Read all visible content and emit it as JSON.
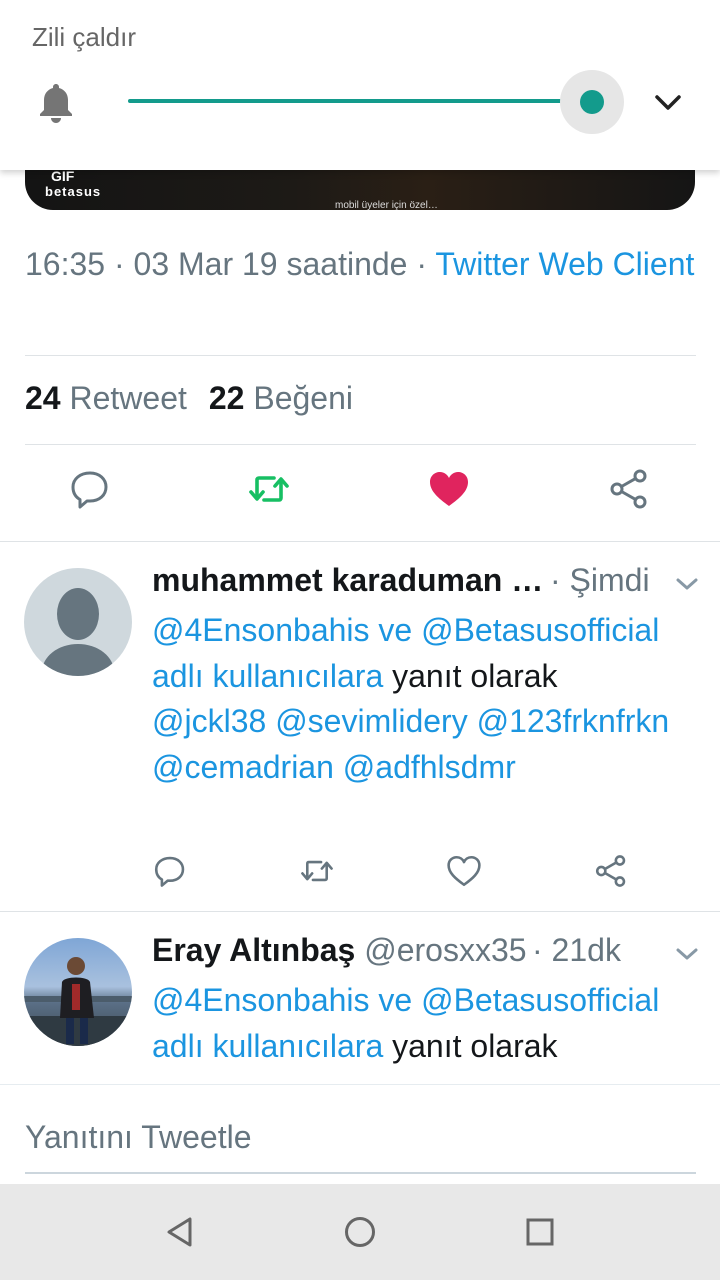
{
  "volume": {
    "title": "Zili çaldır",
    "level": 1.0,
    "accent": "#139b8c",
    "icons": [
      "bell-icon",
      "chevron-down-icon"
    ]
  },
  "media": {
    "gif_label": "GIF",
    "brand": "betasus",
    "caption": "mobil üyeler için özel…"
  },
  "tweet": {
    "time": "16:35 · 03 Mar 19 saatinde · ",
    "client": "Twitter Web Client",
    "retweet_count": "24",
    "retweet_label": "Retweet",
    "like_count": "22",
    "like_label": "Beğeni",
    "liked": true,
    "retweeted": true
  },
  "replies": [
    {
      "name": "muhammet karaduman …",
      "time": "· Şimdi",
      "mention1": "@4Ensonbahis",
      "and": " ve ",
      "mention2": "@Betasusofficial",
      "users_label": " adlı kullanıcılara",
      "reply_label": " yanıt olarak",
      "body": "@jckl38 @sevimlidery @123frknfrkn @cemadrian @adfhlsdmr"
    },
    {
      "name": "Eray Altınbaş",
      "handle": " @erosxx35",
      "time": "· 21dk",
      "mention1": "@4Ensonbahis",
      "and": " ve ",
      "mention2": "@Betasusofficial",
      "users_label": " adlı kullanıcılara",
      "reply_label": " yanıt olarak"
    }
  ],
  "compose": {
    "placeholder": "Yanıtını Tweetle"
  },
  "colors": {
    "link": "#1b95e0",
    "retweet": "#17bf63",
    "like": "#e0245e",
    "secondary_text": "#66757f"
  }
}
